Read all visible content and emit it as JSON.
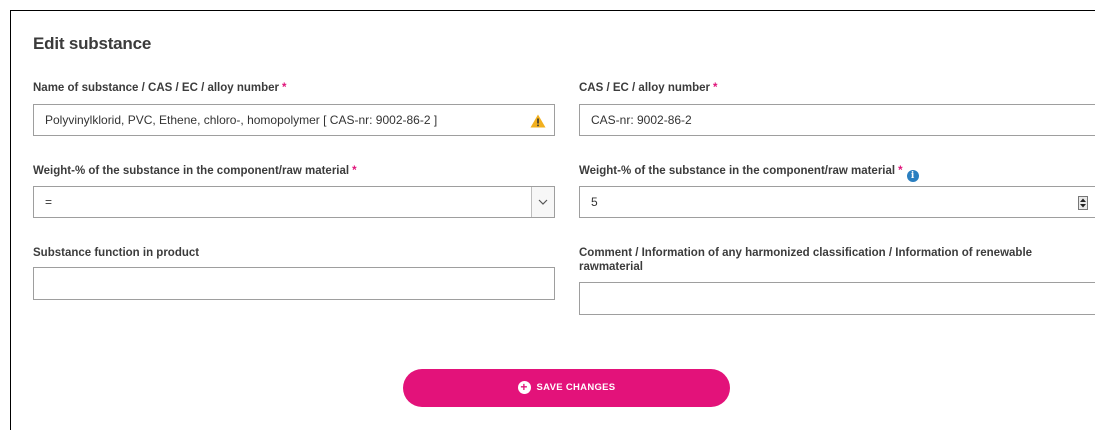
{
  "form": {
    "title": "Edit substance",
    "required_mark": "*",
    "name": {
      "label": "Name of substance / CAS / EC / alloy number",
      "value": "Polyvinylklorid, PVC, Ethene, chloro-, homopolymer [ CAS-nr: 9002-86-2 ]"
    },
    "cas": {
      "label": "CAS / EC / alloy number",
      "value": "CAS-nr: 9002-86-2"
    },
    "weight_op": {
      "label": "Weight-% of the substance in the component/raw material",
      "selected": "="
    },
    "weight_value": {
      "label": "Weight-% of the substance in the component/raw material",
      "value": "5",
      "info_glyph": "i"
    },
    "function": {
      "label": "Substance function in product",
      "value": ""
    },
    "comment": {
      "label": "Comment / Information of any harmonized classification / Information of renewable rawmaterial",
      "value": ""
    },
    "save_label": "SAVE CHANGES",
    "save_glyph": "+"
  },
  "colors": {
    "accent": "#e3127a",
    "warning": "#f2b01e",
    "info": "#2b7fc0"
  },
  "icons": [
    "warning-icon",
    "chevron-down-icon",
    "info-icon",
    "spinner-icon",
    "plus-circle-icon"
  ]
}
